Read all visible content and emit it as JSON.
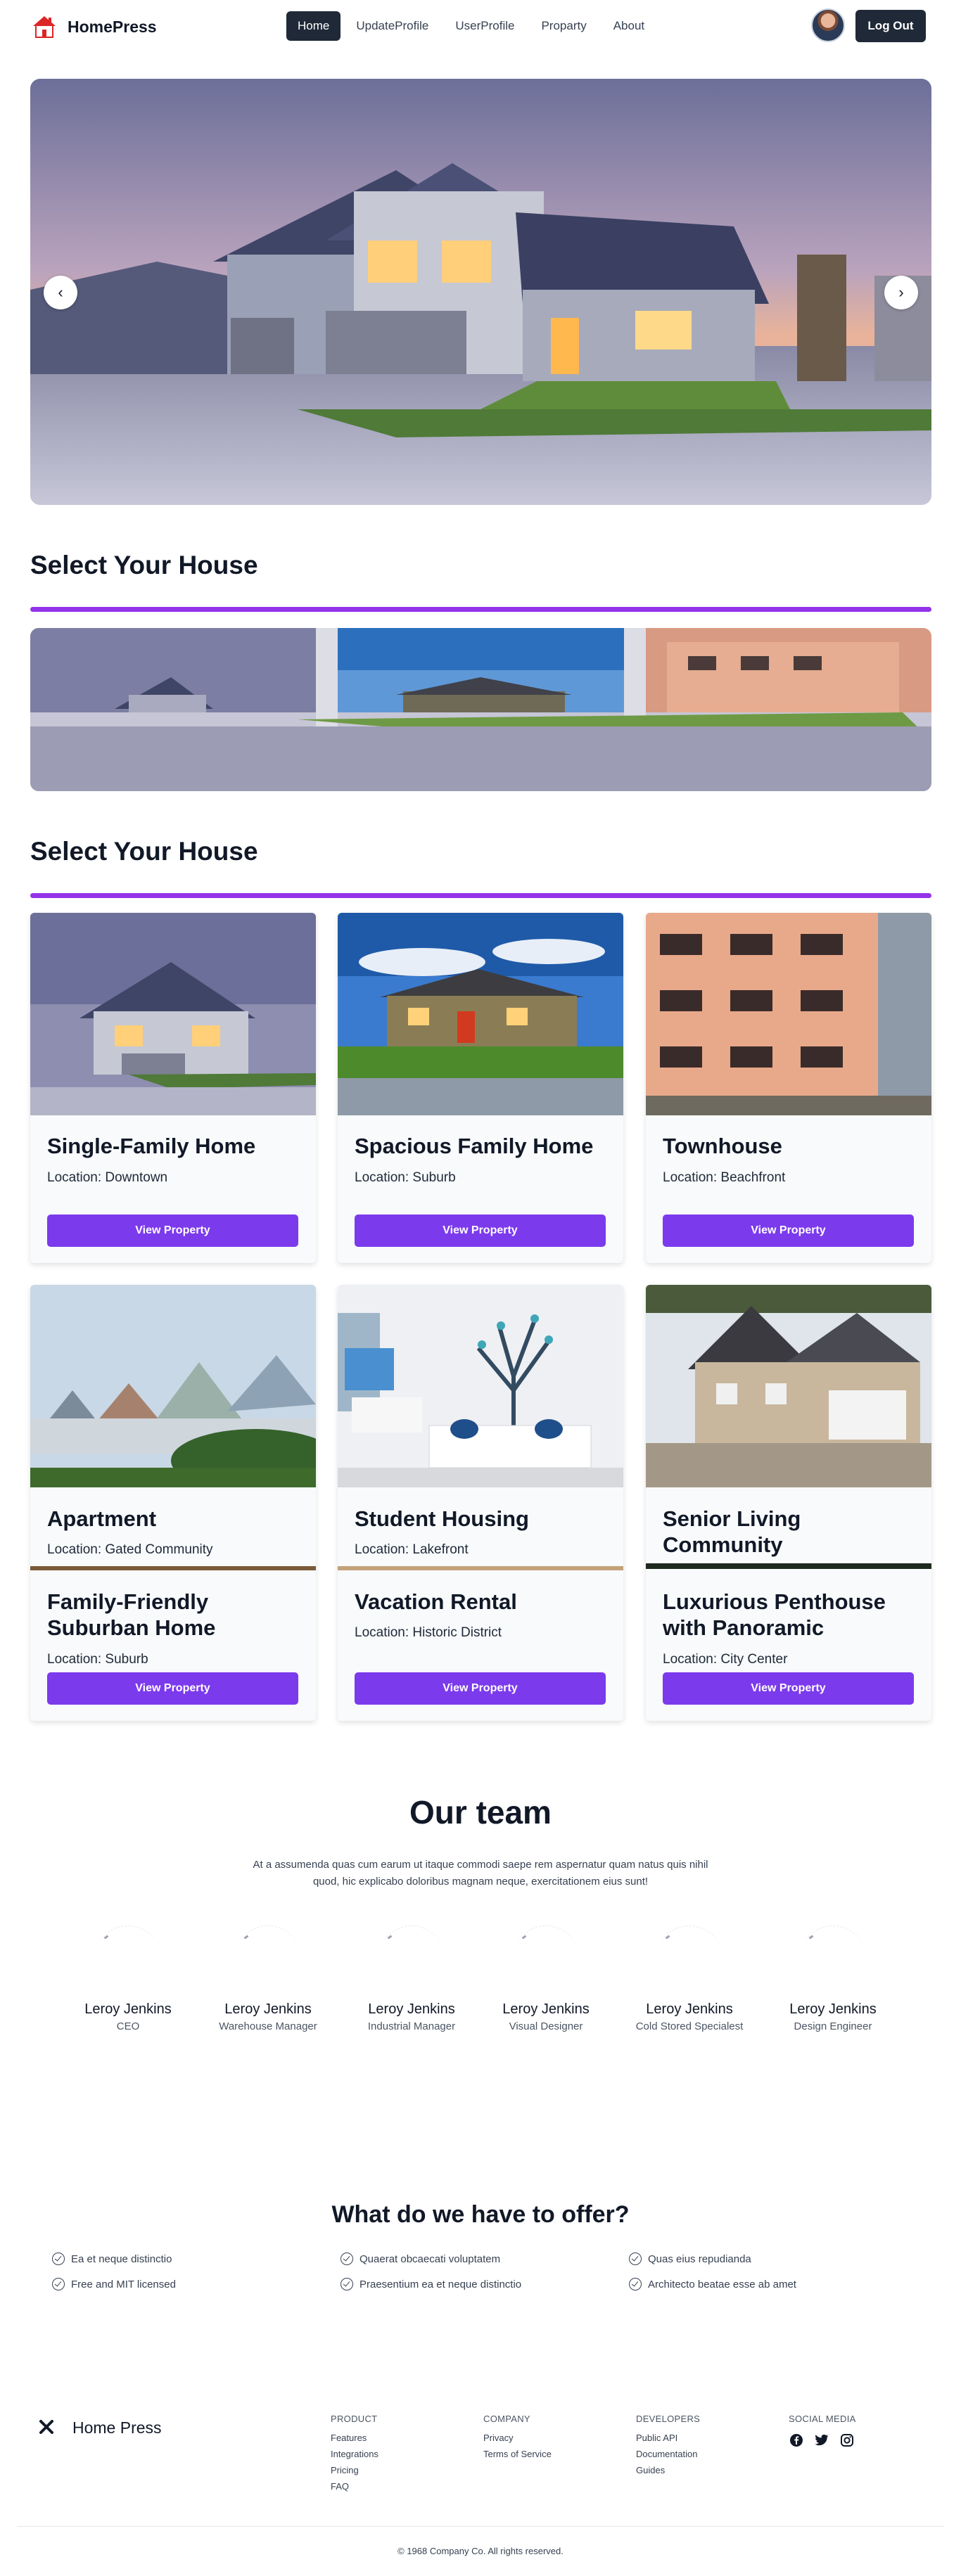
{
  "nav": {
    "brand": "HomePress",
    "links": [
      "Home",
      "UpdateProfile",
      "UserProfile",
      "Proparty",
      "About"
    ],
    "logout": "Log Out"
  },
  "hero": {
    "prev_icon": "‹",
    "next_icon": "›"
  },
  "sections": {
    "select_title_1": "Select Your House",
    "select_title_2": "Select Your House"
  },
  "properties": [
    {
      "title": "Single-Family Home",
      "location": "Location: Downtown",
      "button": "View Property"
    },
    {
      "title": "Spacious Family Home",
      "location": "Location: Suburb",
      "button": "View Property"
    },
    {
      "title": "Townhouse",
      "location": "Location: Beachfront",
      "button": "View Property"
    },
    {
      "title": "Apartment",
      "location": "Location: Gated Community"
    },
    {
      "title": "Student Housing",
      "location": "Location: Lakefront"
    },
    {
      "title": "Senior Living Community",
      "location": ""
    },
    {
      "title": "Family-Friendly Suburban Home",
      "location": "Location: Suburb",
      "button": "View Property"
    },
    {
      "title": "Vacation Rental",
      "location": "Location: Historic District",
      "button": "View Property"
    },
    {
      "title": "Luxurious Penthouse with Panoramic",
      "location": "Location: City Center",
      "button": "View Property"
    }
  ],
  "team": {
    "title": "Our team",
    "text": "At a assumenda quas cum earum ut itaque commodi saepe rem aspernatur quam natus quis nihil quod, hic explicabo doloribus magnam neque, exercitationem eius sunt!",
    "members": [
      {
        "name": "Leroy Jenkins",
        "role": "CEO"
      },
      {
        "name": "Leroy Jenkins",
        "role": "Warehouse Manager"
      },
      {
        "name": "Leroy Jenkins",
        "role": "Industrial Manager"
      },
      {
        "name": "Leroy Jenkins",
        "role": "Visual Designer"
      },
      {
        "name": "Leroy Jenkins",
        "role": "Cold Stored Specialest"
      },
      {
        "name": "Leroy Jenkins",
        "role": "Design Engineer"
      }
    ]
  },
  "offer": {
    "title": "What do we have to offer?",
    "features": [
      "Ea et neque distinctio",
      "Free and MIT licensed",
      "Quaerat obcaecati voluptatem",
      "Praesentium ea et neque distinctio",
      "Quas eius repudianda",
      "Architecto beatae esse ab amet"
    ]
  },
  "footer": {
    "brand": "Home Press",
    "columns": [
      {
        "head": "PRODUCT",
        "items": [
          "Features",
          "Integrations",
          "Pricing",
          "FAQ"
        ]
      },
      {
        "head": "COMPANY",
        "items": [
          "Privacy",
          "Terms of Service"
        ]
      },
      {
        "head": "DEVELOPERS",
        "items": [
          "Public API",
          "Documentation",
          "Guides"
        ]
      },
      {
        "head": "SOCIAL MEDIA",
        "items": []
      }
    ],
    "copyright": "© 1968 Company Co. All rights reserved."
  },
  "colors": {
    "accent": "#7c3aed",
    "divider": "#9333ea",
    "dark": "#1f2937"
  }
}
